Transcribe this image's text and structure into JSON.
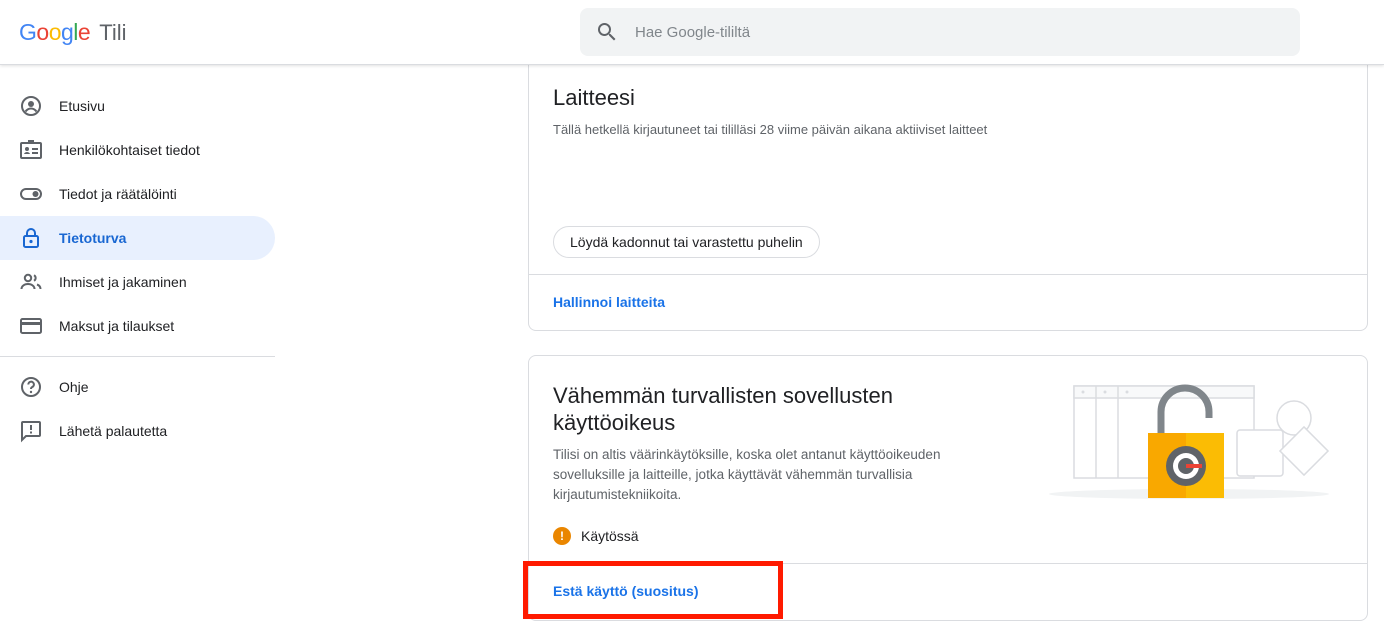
{
  "header": {
    "logo_letters": [
      {
        "ch": "G",
        "color": "#4285F4"
      },
      {
        "ch": "o",
        "color": "#EA4335"
      },
      {
        "ch": "o",
        "color": "#FBBC05"
      },
      {
        "ch": "g",
        "color": "#4285F4"
      },
      {
        "ch": "l",
        "color": "#34A853"
      },
      {
        "ch": "e",
        "color": "#EA4335"
      }
    ],
    "product": "Tili",
    "search_placeholder": "Hae Google-tililtä"
  },
  "sidebar": {
    "items": [
      {
        "label": "Etusivu",
        "icon": "account-circle-icon"
      },
      {
        "label": "Henkilökohtaiset tiedot",
        "icon": "id-card-icon"
      },
      {
        "label": "Tiedot ja räätälöinti",
        "icon": "toggle-icon"
      },
      {
        "label": "Tietoturva",
        "icon": "lock-icon",
        "active": true
      },
      {
        "label": "Ihmiset ja jakaminen",
        "icon": "people-icon"
      },
      {
        "label": "Maksut ja tilaukset",
        "icon": "credit-card-icon"
      }
    ],
    "secondary": [
      {
        "label": "Ohje",
        "icon": "help-icon"
      },
      {
        "label": "Lähetä palautetta",
        "icon": "feedback-icon"
      }
    ]
  },
  "devices_card": {
    "title": "Laitteesi",
    "subtitle": "Tällä hetkellä kirjautuneet tai tililläsi 28 viime päivän aikana aktiiviset laitteet",
    "chip": "Löydä kadonnut tai varastettu puhelin",
    "link": "Hallinnoi laitteita"
  },
  "less_secure_card": {
    "title": "Vähemmän turvallisten sovellusten käyttöoikeus",
    "description": "Tilisi on altis väärinkäytöksille, koska olet antanut käyttöoikeuden sovelluksille ja laitteille, jotka käyttävät vähemmän turvallisia kirjautumistekniikoita.",
    "status": "Käytössä",
    "status_icon": "warning-icon",
    "link": "Estä käyttö (suositus)"
  },
  "colors": {
    "accent": "#1a73e8",
    "active_bg": "#e8f0fe",
    "warning": "#ea8600",
    "highlight": "#ff1a00"
  }
}
